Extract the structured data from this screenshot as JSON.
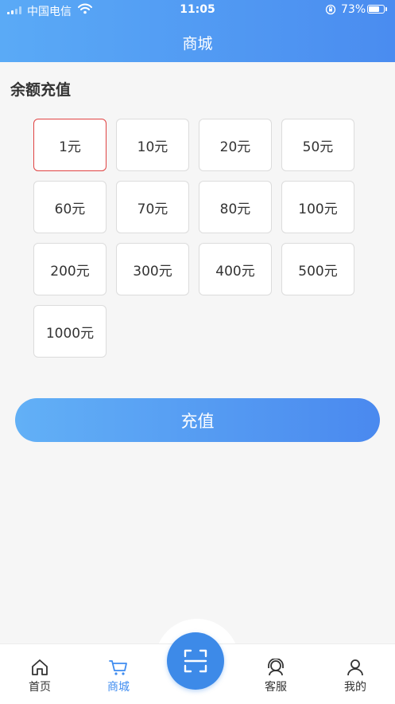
{
  "status_bar": {
    "carrier": "中国电信",
    "time": "11:05",
    "battery": "73%",
    "battery_level": 0.73
  },
  "header": {
    "title": "商城"
  },
  "section": {
    "title": "余额充值"
  },
  "amounts": [
    "1元",
    "10元",
    "20元",
    "50元",
    "60元",
    "70元",
    "80元",
    "100元",
    "200元",
    "300元",
    "400元",
    "500元",
    "1000元"
  ],
  "selected_index": 0,
  "recharge_label": "充值",
  "tabbar": {
    "home": "首页",
    "shop": "商城",
    "service": "客服",
    "mine": "我的",
    "active": "shop"
  },
  "colors": {
    "accent": "#3f8cf0",
    "selected_border": "#e04343",
    "header_start": "#5aaaf6",
    "header_end": "#4a8cf0"
  }
}
